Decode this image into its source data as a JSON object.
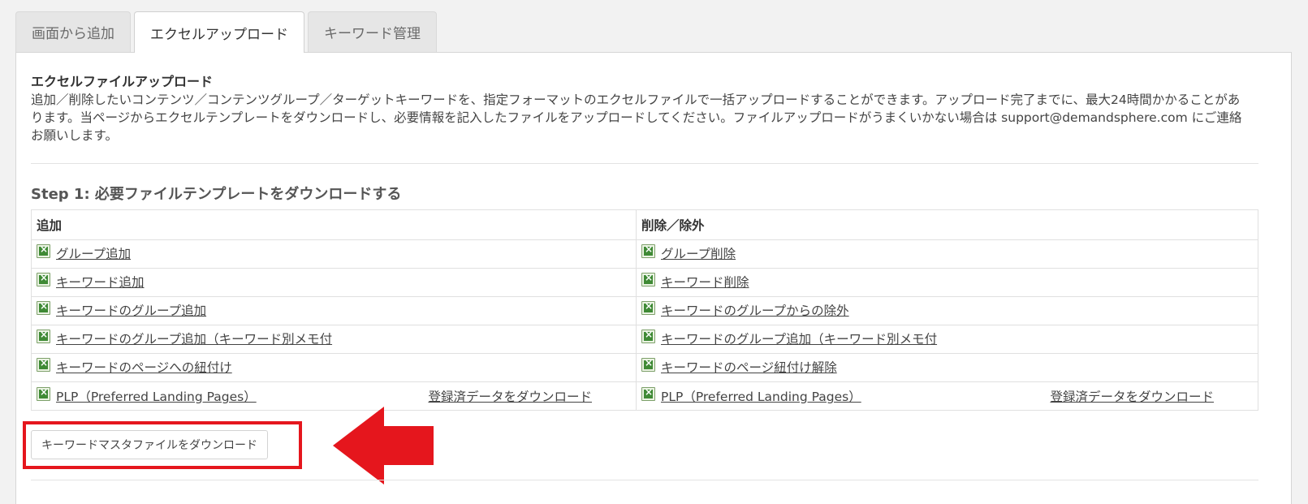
{
  "tabs": [
    {
      "label": "画面から追加",
      "active": false
    },
    {
      "label": "エクセルアップロード",
      "active": true
    },
    {
      "label": "キーワード管理",
      "active": false
    }
  ],
  "section": {
    "title": "エクセルファイルアップロード",
    "description": "追加／削除したいコンテンツ／コンテンツグループ／ターゲットキーワードを、指定フォーマットのエクセルファイルで一括アップロードすることができます。アップロード完了までに、最大24時間かかることがあります。当ページからエクセルテンプレートをダウンロードし、必要情報を記入したファイルをアップロードしてください。ファイルアップロードがうまくいかない場合は support@demandsphere.com にご連絡お願いします。"
  },
  "step1": {
    "title": "Step 1: 必要ファイルテンプレートをダウンロードする",
    "headers": {
      "add": "追加",
      "remove": "削除／除外"
    },
    "rows": [
      {
        "add": "グループ追加",
        "remove": "グループ削除"
      },
      {
        "add": "キーワード追加",
        "remove": "キーワード削除"
      },
      {
        "add": "キーワードのグループ追加",
        "remove": "キーワードのグループからの除外"
      },
      {
        "add": "キーワードのグループ追加（キーワード別メモ付",
        "remove": "キーワードのグループ追加（キーワード別メモ付"
      },
      {
        "add": "キーワードのページへの紐付け",
        "remove": "キーワードのページ紐付け解除"
      },
      {
        "add": "PLP（Preferred Landing Pages）",
        "add_extra": "登録済データをダウンロード",
        "remove": "PLP（Preferred Landing Pages）",
        "remove_extra": "登録済データをダウンロード"
      }
    ],
    "download_button": "キーワードマスタファイルをダウンロード"
  },
  "icons": {
    "template": "excel-file-icon",
    "annotation": "red-arrow-icon"
  },
  "colors": {
    "highlight": "#e5161d",
    "excel": "#3f8a35"
  }
}
